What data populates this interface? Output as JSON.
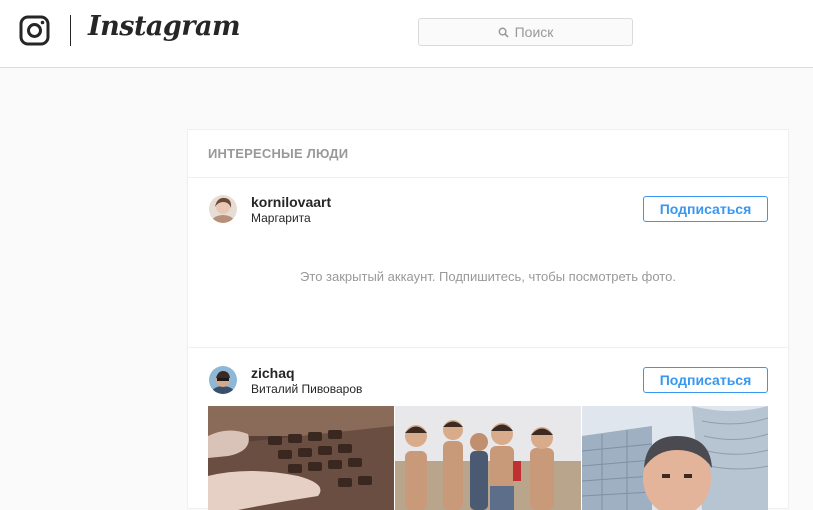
{
  "header": {
    "logo_text": "Instagram",
    "search_placeholder": "Поиск",
    "camera_icon": "instagram-camera-icon",
    "search_icon": "search-icon"
  },
  "suggestions": {
    "title": "ИНТЕРЕСНЫЕ ЛЮДИ",
    "users": [
      {
        "username": "kornilovaart",
        "full_name": "Маргарита",
        "follow_label": "Подписаться",
        "private_message": "Это закрытый аккаунт. Подпишитесь, чтобы посмотреть фото."
      },
      {
        "username": "zichaq",
        "full_name": "Виталий Пивоваров",
        "follow_label": "Подписаться",
        "photos": [
          "photo-hand-with-chocolate",
          "photo-group-of-young-men-beach",
          "photo-selfie-building"
        ]
      }
    ]
  },
  "colors": {
    "accent": "#3897f0",
    "muted_text": "#999999",
    "background": "#fafafa",
    "border": "#dbdbdb"
  }
}
